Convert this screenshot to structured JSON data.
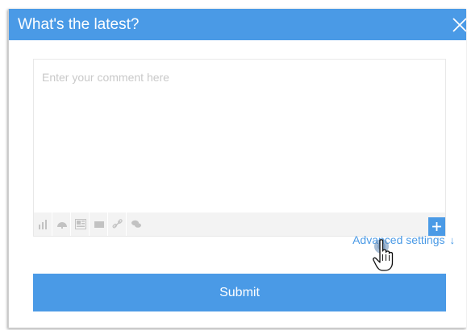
{
  "dialog": {
    "title": "What's the latest?",
    "close_icon": "close-icon"
  },
  "comment": {
    "placeholder": "Enter your comment here",
    "value": ""
  },
  "toolbar": {
    "tools": [
      "bar-chart-icon",
      "dashboard-icon",
      "report-icon",
      "storyboard-icon",
      "link-icon",
      "comment-icon"
    ],
    "add_icon": "plus-icon"
  },
  "advanced": {
    "label": "Advanced settings",
    "arrow": "↓"
  },
  "submit": {
    "label": "Submit"
  },
  "colors": {
    "accent": "#4a9ae6",
    "toolbar_bg": "#f3f3f3",
    "tool_icon": "#c2c2c2"
  }
}
